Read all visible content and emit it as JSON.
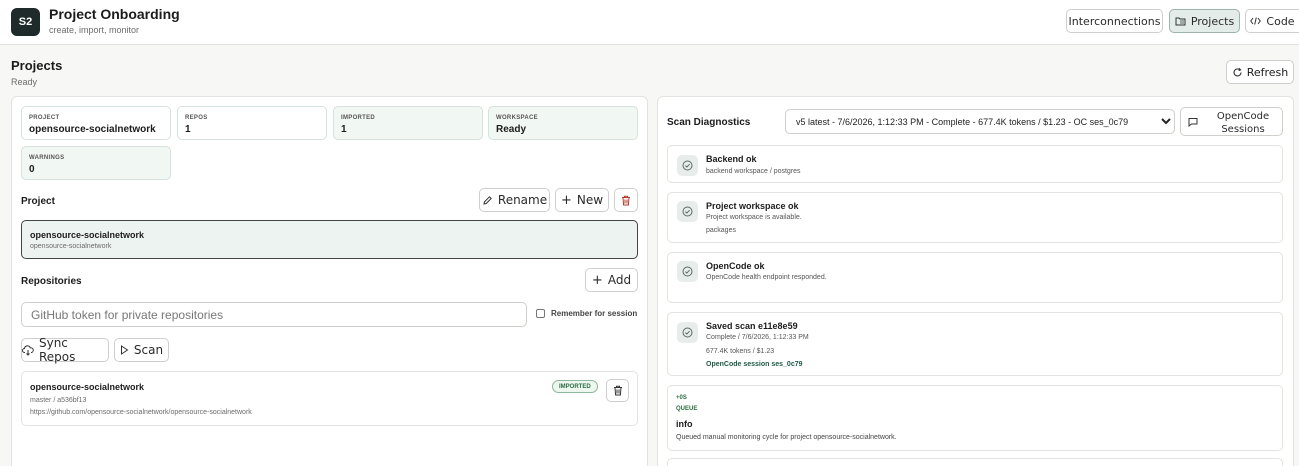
{
  "header": {
    "logo": "S2",
    "title": "Project Onboarding",
    "subtitle": "create, import, monitor",
    "nav": [
      {
        "label": "Interconnections",
        "icon": ""
      },
      {
        "label": "Projects",
        "icon": "folder-icon"
      },
      {
        "label": "Code",
        "icon": "code-icon"
      }
    ],
    "active_nav": "Projects"
  },
  "page": {
    "title": "Projects",
    "status": "Ready",
    "refresh_label": "Refresh"
  },
  "stats": [
    {
      "key": "PROJECT",
      "value": "opensource-socialnetwork"
    },
    {
      "key": "REPOS",
      "value": "1"
    },
    {
      "key": "IMPORTED",
      "value": "1"
    },
    {
      "key": "WORKSPACE",
      "value": "Ready"
    },
    {
      "key": "WARNINGS",
      "value": "0"
    }
  ],
  "project": {
    "heading": "Project",
    "rename_label": "Rename",
    "new_label": "New",
    "selected_name": "opensource-socialnetwork",
    "selected_slug": "opensource-socialnetwork"
  },
  "repositories": {
    "heading": "Repositories",
    "add_label": "Add",
    "token_placeholder": "GitHub token for private repositories",
    "token_value": "",
    "remember_label": "Remember for session",
    "sync_label": "Sync Repos",
    "scan_label": "Scan",
    "items": [
      {
        "name": "opensource-socialnetwork",
        "branch": "master / a536bf13",
        "url": "https://github.com/opensource-socialnetwork/opensource-socialnetwork",
        "badge": "IMPORTED"
      }
    ]
  },
  "diagnostics": {
    "title": "Scan Diagnostics",
    "selected_scan": "v5 latest - 7/6/2026, 1:12:33 PM - Complete - 677.4K tokens / $1.23 - OC ses_0c79",
    "sessions_label": "OpenCode Sessions",
    "checks": [
      {
        "title": "Backend ok",
        "details": [
          "backend workspace / postgres"
        ]
      },
      {
        "title": "Project workspace ok",
        "details": [
          "Project workspace is available.",
          "packages"
        ]
      },
      {
        "title": "OpenCode ok",
        "details": [
          "OpenCode health endpoint responded."
        ]
      },
      {
        "title": "Saved scan e11e8e59",
        "details": [
          "Complete / 7/6/2026, 1:12:33 PM",
          "677.4K tokens / $1.23"
        ],
        "link": "OpenCode session ses_0c79"
      }
    ],
    "event": {
      "time": "+0S",
      "tag": "QUEUE",
      "level": "info",
      "message": "Queued manual monitoring cycle for project opensource-socialnetwork."
    }
  }
}
